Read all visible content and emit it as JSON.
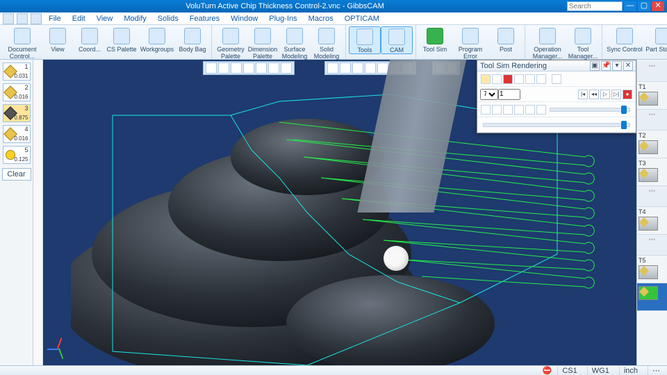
{
  "app": {
    "title": "VoluTurn Active Chip Thickness Control-2.vnc - GibbsCAM"
  },
  "search": {
    "placeholder": "Search"
  },
  "winbtns": {
    "min": "—",
    "max": "▢",
    "close": "✕"
  },
  "quick": [
    "app-icon",
    "new",
    "open",
    "save"
  ],
  "menu": [
    "File",
    "Edit",
    "View",
    "Modify",
    "Solids",
    "Features",
    "Window",
    "Plug-Ins",
    "Macros",
    "OPTICAM"
  ],
  "ribbon": {
    "groups": [
      {
        "items": [
          {
            "id": "document-control",
            "label": "Document Control..."
          },
          {
            "id": "view",
            "label": "View"
          },
          {
            "id": "coord",
            "label": "Coord..."
          },
          {
            "id": "cs-palette",
            "label": "CS Palette"
          },
          {
            "id": "workgroups",
            "label": "Workgroups"
          },
          {
            "id": "body-bag",
            "label": "Body Bag"
          }
        ]
      },
      {
        "items": [
          {
            "id": "geometry-palette",
            "label": "Geometry Palette"
          },
          {
            "id": "dimension-palette",
            "label": "Dimension Palette"
          },
          {
            "id": "surface-modeling",
            "label": "Surface Modeling"
          },
          {
            "id": "solid-modeling",
            "label": "Solid Modeling"
          }
        ]
      },
      {
        "items": [
          {
            "id": "tools",
            "label": "Tools",
            "active": true
          },
          {
            "id": "cam",
            "label": "CAM",
            "active": true
          }
        ]
      },
      {
        "items": [
          {
            "id": "tool-sim",
            "label": "Tool Sim",
            "green": true
          },
          {
            "id": "program-error-checker",
            "label": "Program Error Checker"
          },
          {
            "id": "post",
            "label": "Post"
          }
        ]
      },
      {
        "items": [
          {
            "id": "operation-manager",
            "label": "Operation Manager..."
          },
          {
            "id": "tool-manager",
            "label": "Tool Manager..."
          }
        ]
      },
      {
        "items": [
          {
            "id": "sync-control",
            "label": "Sync Control"
          },
          {
            "id": "part-stations",
            "label": "Part Stations"
          }
        ]
      }
    ]
  },
  "left_tools": [
    {
      "id": 1,
      "color": "#e9c34a",
      "txtcolor": "#111",
      "value": "0.031"
    },
    {
      "id": 2,
      "color": "#e9c34a",
      "txtcolor": "#111",
      "value": "0.016"
    },
    {
      "id": 3,
      "color": "#555",
      "txtcolor": "#fff",
      "value": "0.875"
    },
    {
      "id": 4,
      "color": "#e9c34a",
      "txtcolor": "#111",
      "value": "0.016"
    },
    {
      "id": 5,
      "color": "#ffd21f",
      "txtcolor": "#111",
      "value": "0.125"
    }
  ],
  "left_labels": {
    "clear": "Clear"
  },
  "sim_panel": {
    "title": "Tool Sim Rendering",
    "speed_value": "7",
    "speed_scale": "1",
    "opts": [
      "sun",
      "fill",
      "edge",
      "bars",
      "menu",
      "drop"
    ],
    "transport": [
      "skip-back",
      "step-back",
      "play",
      "step-fwd",
      "skip-fwd",
      "record"
    ],
    "shade_opts": [
      "a",
      "b",
      "c",
      "d",
      "e",
      "f"
    ]
  },
  "right_tracks": [
    {
      "label": "T1",
      "sub": "1"
    },
    {
      "label": "T2",
      "sub": "2"
    },
    {
      "label": "T3",
      "sub": "3"
    },
    {
      "label": "T4",
      "sub": "4"
    },
    {
      "label": "T5",
      "sub": "5"
    }
  ],
  "status": {
    "cs": "CS1",
    "wg": "WG1",
    "unit": "inch"
  }
}
